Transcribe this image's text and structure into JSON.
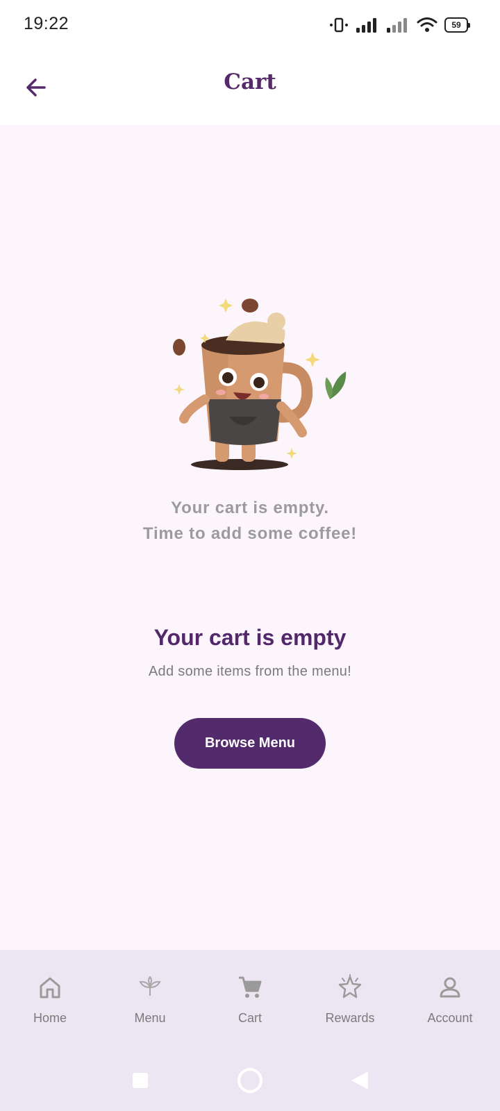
{
  "status_bar": {
    "time": "19:22",
    "battery": "59",
    "icons": [
      "vibrate-icon",
      "signal-icon",
      "signal-weak-icon",
      "wifi-icon",
      "battery-icon"
    ]
  },
  "header": {
    "title": "Cart",
    "back_icon": "arrow-left-icon"
  },
  "illustration": {
    "caption_line1": "Your cart is empty.",
    "caption_line2": "Time to add some coffee!"
  },
  "empty_state": {
    "title": "Your cart is empty",
    "subtitle": "Add some items from the menu!",
    "button_label": "Browse Menu"
  },
  "bottom_nav": {
    "items": [
      {
        "label": "Home",
        "icon": "home-icon"
      },
      {
        "label": "Menu",
        "icon": "leaf-icon"
      },
      {
        "label": "Cart",
        "icon": "cart-icon"
      },
      {
        "label": "Rewards",
        "icon": "star-icon"
      },
      {
        "label": "Account",
        "icon": "person-icon"
      }
    ]
  },
  "system_nav": {
    "icons": [
      "recents-icon",
      "home-circle-icon",
      "back-triangle-icon"
    ]
  },
  "colors": {
    "primary": "#532a6b",
    "content_bg": "#fcf6fc",
    "nav_bg": "#ece6f3",
    "caption_grey": "#9b9b9b"
  }
}
